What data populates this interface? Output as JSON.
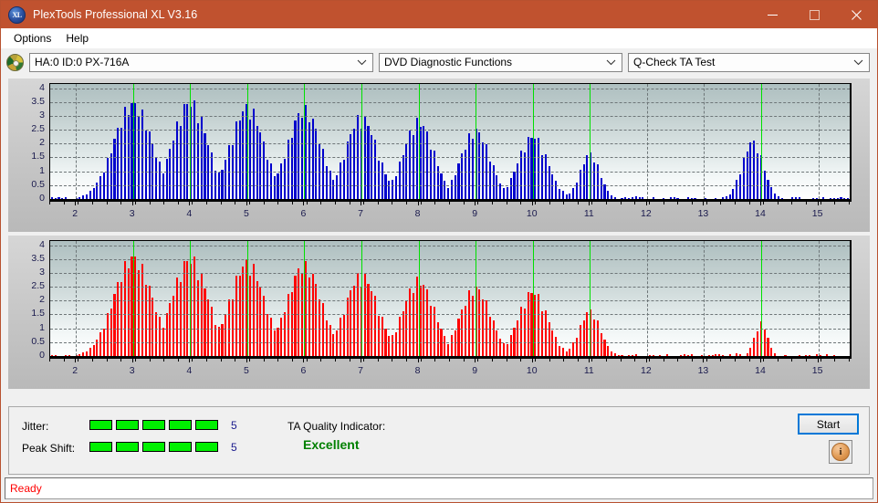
{
  "window": {
    "title": "PlexTools Professional XL V3.16",
    "app_icon": "xl-logo-icon",
    "minimize_label": "minimize-icon",
    "maximize_label": "maximize-icon",
    "close_label": "close-icon"
  },
  "menu": {
    "items": [
      {
        "label": "Options"
      },
      {
        "label": "Help"
      }
    ]
  },
  "toolbar": {
    "drive_icon": "disc-icon",
    "drive_select": "HA:0 ID:0  PX-716A",
    "function_select": "DVD Diagnostic Functions",
    "test_select": "Q-Check TA Test"
  },
  "status_panel": {
    "jitter_label": "Jitter:",
    "jitter_value": "5",
    "jitter_segments_on": 5,
    "jitter_segments_total": 5,
    "peak_shift_label": "Peak Shift:",
    "peak_shift_value": "5",
    "peak_shift_segments_on": 5,
    "peak_shift_segments_total": 5,
    "ta_label": "TA Quality Indicator:",
    "ta_value": "Excellent",
    "ta_color": "#008000",
    "start_label": "Start",
    "info_label": "info-icon"
  },
  "statusbar": {
    "text": "Ready",
    "color": "#ff0000"
  },
  "colors": {
    "titlebar": "#c0522f",
    "top_series": "#0000cc",
    "bottom_series": "#ff0000",
    "marker": "#00e000",
    "meter_on": "#00f000"
  },
  "chart_data": [
    {
      "id": "top-chart",
      "type": "bar",
      "title": "",
      "xlabel": "",
      "ylabel": "",
      "color": "#0000cc",
      "xlim": [
        1.55,
        15.55
      ],
      "ylim": [
        0,
        4.15
      ],
      "yticks": [
        0,
        0.5,
        1,
        1.5,
        2,
        2.5,
        3,
        3.5,
        4
      ],
      "ytick_labels": [
        "0",
        "0.5",
        "1",
        "1.5",
        "2",
        "2.5",
        "3",
        "3.5",
        "4"
      ],
      "xticks": [
        2,
        3,
        4,
        5,
        6,
        7,
        8,
        9,
        10,
        11,
        12,
        13,
        14,
        15
      ],
      "xtick_labels": [
        "2",
        "3",
        "4",
        "5",
        "6",
        "7",
        "8",
        "9",
        "10",
        "11",
        "12",
        "13",
        "14",
        "15"
      ],
      "grid": true,
      "markers": [
        3,
        4,
        5,
        6,
        7,
        8,
        9,
        10,
        11,
        14
      ],
      "peaks": [
        {
          "center": 3.0,
          "height": 3.62,
          "half_width": 0.55
        },
        {
          "center": 4.0,
          "height": 3.7,
          "half_width": 0.5
        },
        {
          "center": 5.0,
          "height": 3.5,
          "half_width": 0.48
        },
        {
          "center": 6.0,
          "height": 3.4,
          "half_width": 0.48
        },
        {
          "center": 7.0,
          "height": 3.12,
          "half_width": 0.46
        },
        {
          "center": 8.0,
          "height": 2.95,
          "half_width": 0.44
        },
        {
          "center": 9.0,
          "height": 2.62,
          "half_width": 0.42
        },
        {
          "center": 10.0,
          "height": 2.4,
          "half_width": 0.42
        },
        {
          "center": 11.0,
          "height": 1.72,
          "half_width": 0.28
        },
        {
          "center": 13.85,
          "height": 2.2,
          "half_width": 0.3
        }
      ],
      "bar_count": 230,
      "noise_floor": 0.06
    },
    {
      "id": "bottom-chart",
      "type": "bar",
      "title": "",
      "xlabel": "",
      "ylabel": "",
      "color": "#ff0000",
      "xlim": [
        1.55,
        15.55
      ],
      "ylim": [
        0,
        4.15
      ],
      "yticks": [
        0,
        0.5,
        1,
        1.5,
        2,
        2.5,
        3,
        3.5,
        4
      ],
      "ytick_labels": [
        "0",
        "0.5",
        "1",
        "1.5",
        "2",
        "2.5",
        "3",
        "3.5",
        "4"
      ],
      "xticks": [
        2,
        3,
        4,
        5,
        6,
        7,
        8,
        9,
        10,
        11,
        12,
        13,
        14,
        15
      ],
      "xtick_labels": [
        "2",
        "3",
        "4",
        "5",
        "6",
        "7",
        "8",
        "9",
        "10",
        "11",
        "12",
        "13",
        "14",
        "15"
      ],
      "grid": true,
      "markers": [
        3,
        4,
        5,
        6,
        7,
        8,
        9,
        10,
        11,
        14
      ],
      "peaks": [
        {
          "center": 3.0,
          "height": 3.75,
          "half_width": 0.55
        },
        {
          "center": 4.0,
          "height": 3.7,
          "half_width": 0.52
        },
        {
          "center": 5.0,
          "height": 3.55,
          "half_width": 0.5
        },
        {
          "center": 6.0,
          "height": 3.45,
          "half_width": 0.5
        },
        {
          "center": 7.0,
          "height": 3.08,
          "half_width": 0.48
        },
        {
          "center": 8.0,
          "height": 2.88,
          "half_width": 0.46
        },
        {
          "center": 9.0,
          "height": 2.6,
          "half_width": 0.44
        },
        {
          "center": 10.0,
          "height": 2.45,
          "half_width": 0.42
        },
        {
          "center": 11.0,
          "height": 1.72,
          "half_width": 0.3
        },
        {
          "center": 14.0,
          "height": 1.25,
          "half_width": 0.18
        }
      ],
      "bar_count": 230,
      "noise_floor": 0.06
    }
  ]
}
